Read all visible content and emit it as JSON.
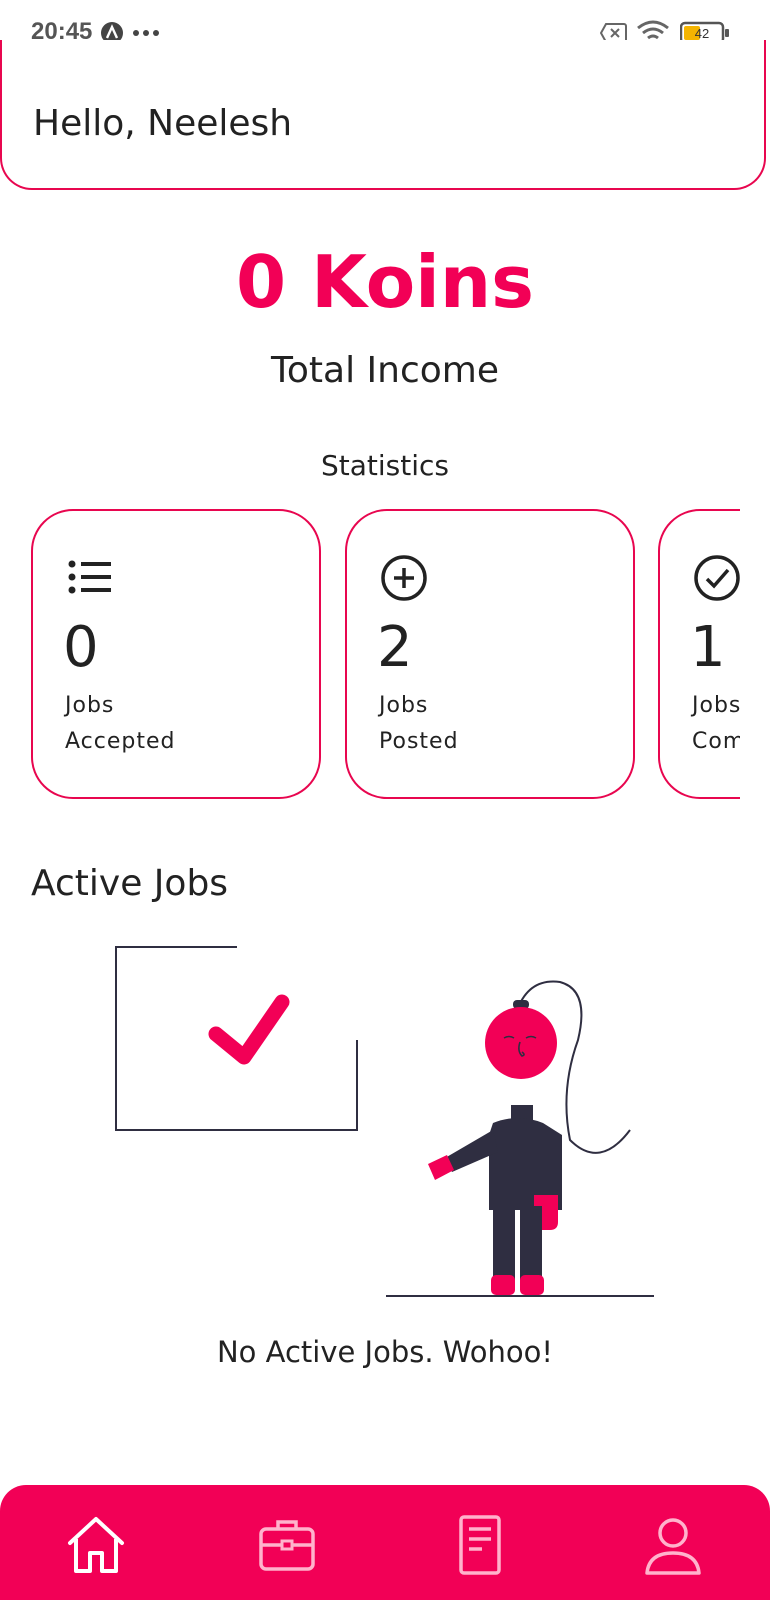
{
  "status_bar": {
    "time": "20:45",
    "battery": "42"
  },
  "header": {
    "greeting": "Hello, Neelesh"
  },
  "income": {
    "amount": "0 Koins",
    "label": "Total Income"
  },
  "statistics": {
    "title": "Statistics",
    "cards": [
      {
        "icon": "list-icon",
        "value": "0",
        "line1": "Jobs",
        "line2": "Accepted"
      },
      {
        "icon": "plus-circle-icon",
        "value": "2",
        "line1": "Jobs",
        "line2": "Posted"
      },
      {
        "icon": "check-circle-icon",
        "value": "1",
        "line1": "Jobs",
        "line2": "Com"
      }
    ]
  },
  "active_jobs": {
    "title": "Active Jobs",
    "empty_message": "No Active Jobs. Wohoo!"
  },
  "nav": {
    "items": [
      "home-icon",
      "briefcase-icon",
      "document-icon",
      "profile-icon"
    ]
  },
  "colors": {
    "accent": "#f20056",
    "dark": "#2f2e41"
  }
}
